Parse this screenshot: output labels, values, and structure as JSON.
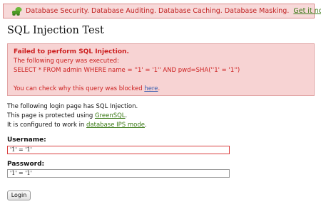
{
  "banner": {
    "text": "Database Security. Database Auditing. Database Caching. Database Masking.",
    "link_label": "Get it now",
    "logo_icon": "greensql-logo-icon"
  },
  "page": {
    "title": "SQL Injection Test"
  },
  "error": {
    "heading": "Failed to perform SQL Injection.",
    "line1": "The following query was executed:",
    "query": "SELECT * FROM admin WHERE name = ''1' = '1'' AND pwd=SHA(''1' = '1'')",
    "blocked_prefix": "You can check why this query was blocked ",
    "blocked_link": "here",
    "blocked_suffix": "."
  },
  "info": {
    "line1": "The following login page has SQL Injection.",
    "line2_prefix": "This page is protected using ",
    "line2_link": "GreenSQL",
    "line2_suffix": ".",
    "line3_prefix": "It is configured to work in ",
    "line3_link": "database IPS mode",
    "line3_suffix": "."
  },
  "form": {
    "username_label": "Username:",
    "username_value": "'1' = '1'",
    "password_label": "Password:",
    "password_value": "'1' = '1'",
    "login_label": "Login"
  },
  "colors": {
    "banner_bg": "#f7d9d9",
    "error_text": "#cc1f1f",
    "link_green": "#3b7a16"
  }
}
